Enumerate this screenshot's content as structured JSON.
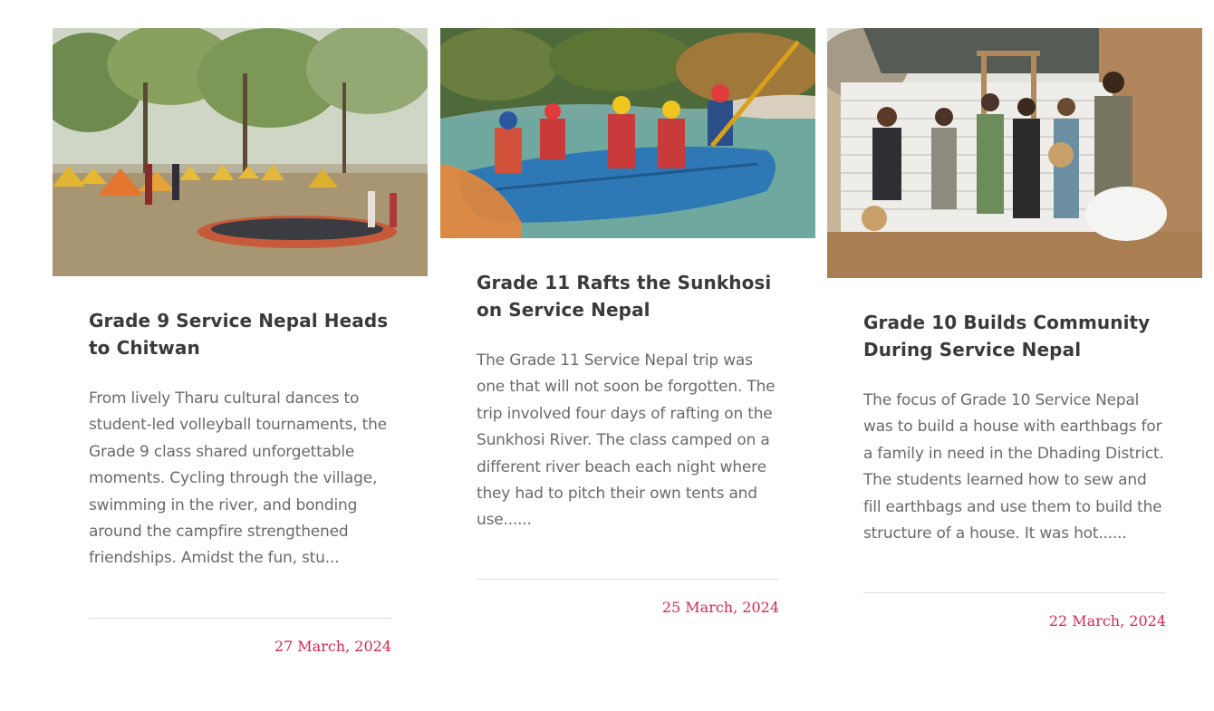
{
  "articles": [
    {
      "image_alt": "Grade 9 students camping with yellow tents in Chitwan",
      "title": "Grade 9 Service Nepal Heads to Chitwan",
      "excerpt": "From lively Tharu cultural dances to student-led volleyball tournaments, the Grade 9 class shared unforgettable moments. Cycling through the village, swimming in the river, and bonding around the campfire strengthened friendships. Amidst the fun, stu...",
      "date": "27 March, 2024"
    },
    {
      "image_alt": "Grade 11 students rafting on the Sunkhosi River",
      "title": "Grade 11 Rafts the Sunkhosi on Service Nepal",
      "excerpt": "The Grade 11 Service Nepal trip was one that will not soon be forgotten. The trip involved four days of rafting on the Sunkhosi River. The class camped on a different river beach each night where they had to pitch their own tents and use......",
      "date": "25 March, 2024"
    },
    {
      "image_alt": "Grade 10 students building an earthbag house",
      "title": "Grade 10 Builds Community During Service Nepal",
      "excerpt": "The focus of Grade 10 Service Nepal was to build a house with earthbags for a family in need in the Dhading District. The students learned how to sew and fill earthbags and use them to build the structure of a house. It was hot......",
      "date": "22 March, 2024"
    }
  ],
  "colors": {
    "title": "#3a3a3a",
    "excerpt": "#6a6a6a",
    "date": "#d6284b",
    "divider": "#dcdcdc"
  }
}
